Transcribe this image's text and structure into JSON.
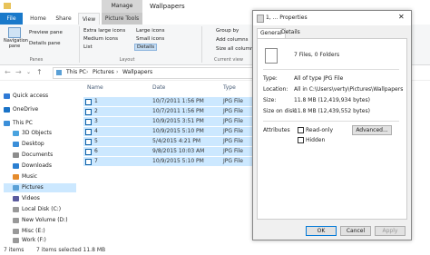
{
  "window": {
    "title": "Wallpapers",
    "context_tab": "Manage",
    "minimize": "—",
    "maximize": "☐",
    "close": "✕"
  },
  "ribbon_tabs": [
    "File",
    "Home",
    "Share",
    "View",
    "Picture Tools"
  ],
  "ribbon": {
    "nav_pane": "Navigation pane",
    "preview_pane": "Preview pane",
    "details_pane": "Details pane",
    "panes_group": "Panes",
    "layout_items": [
      "Extra large icons",
      "Large icons",
      "Medium icons",
      "Small icons",
      "List",
      "Details"
    ],
    "layout_group": "Layout",
    "group_by": "Group by",
    "add_columns": "Add columns",
    "size_all": "Size all columns to fit",
    "current_view_group": "Current view"
  },
  "address": {
    "path": [
      "This PC",
      "Pictures",
      "Wallpapers"
    ]
  },
  "nav": [
    {
      "label": "Quick access",
      "color": "#2f7ad6"
    },
    {
      "label": "OneDrive",
      "color": "#1a73c7"
    },
    {
      "label": "This PC",
      "color": "#3b8fd9"
    },
    {
      "label": "3D Objects",
      "color": "#4aa3df"
    },
    {
      "label": "Desktop",
      "color": "#3b8fd9"
    },
    {
      "label": "Documents",
      "color": "#8d8d8d"
    },
    {
      "label": "Downloads",
      "color": "#2b7fd1"
    },
    {
      "label": "Music",
      "color": "#e58b2c"
    },
    {
      "label": "Pictures",
      "color": "#5aa0d6"
    },
    {
      "label": "Videos",
      "color": "#5b5b9e"
    },
    {
      "label": "Local Disk (C:)",
      "color": "#999"
    },
    {
      "label": "New Volume (D:)",
      "color": "#999"
    },
    {
      "label": "Misc (E:)",
      "color": "#999"
    },
    {
      "label": "Work (F:)",
      "color": "#999"
    }
  ],
  "columns": [
    "Name",
    "Date",
    "Type"
  ],
  "files": [
    {
      "name": "1",
      "date": "10/7/2011 1:56 PM",
      "type": "JPG File"
    },
    {
      "name": "2",
      "date": "10/7/2011 1:56 PM",
      "type": "JPG File"
    },
    {
      "name": "3",
      "date": "10/9/2015 3:51 PM",
      "type": "JPG File"
    },
    {
      "name": "4",
      "date": "10/9/2015 5:10 PM",
      "type": "JPG File"
    },
    {
      "name": "5",
      "date": "5/4/2015 4:21 PM",
      "type": "JPG File"
    },
    {
      "name": "6",
      "date": "9/8/2015 10:03 AM",
      "type": "JPG File"
    },
    {
      "name": "7",
      "date": "10/9/2015 5:10 PM",
      "type": "JPG File"
    }
  ],
  "status": {
    "items": "7 items",
    "selected": "7 items selected 11.8 MB"
  },
  "dialog": {
    "title": "1, ... Properties",
    "tabs": [
      "General",
      "Details"
    ],
    "summary": "7 Files, 0 Folders",
    "type_label": "Type:",
    "type_value": "All of type JPG File",
    "location_label": "Location:",
    "location_value": "All in C:\\Users\\verty\\Pictures\\Wallpapers",
    "size_label": "Size:",
    "size_value": "11.8 MB (12,419,934 bytes)",
    "disk_label": "Size on disk:",
    "disk_value": "11.8 MB (12,439,552 bytes)",
    "attributes_label": "Attributes",
    "readonly": "Read-only",
    "hidden": "Hidden",
    "advanced": "Advanced...",
    "ok": "OK",
    "cancel": "Cancel",
    "apply": "Apply"
  }
}
